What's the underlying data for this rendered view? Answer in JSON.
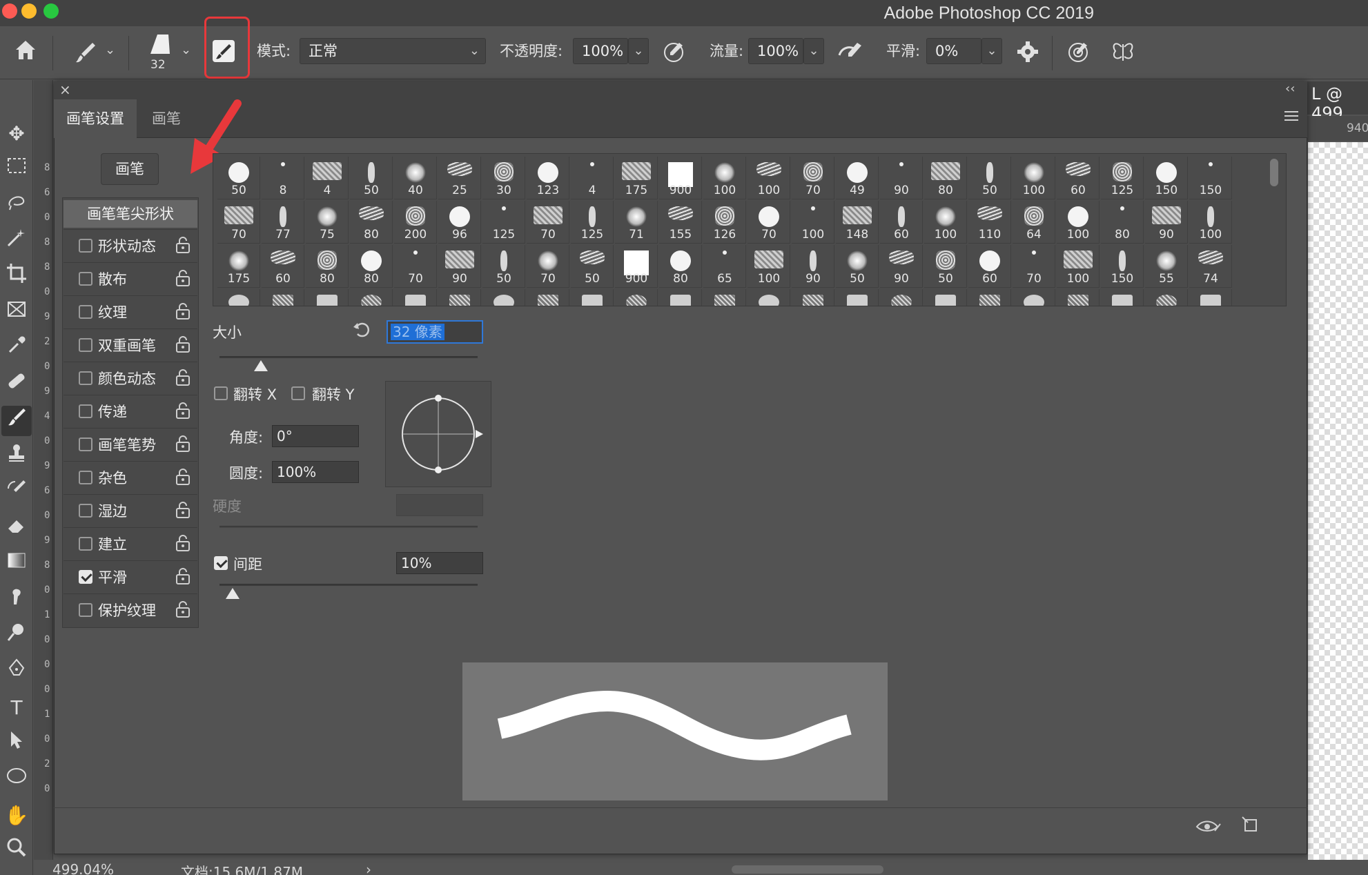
{
  "app": {
    "title": "Adobe Photoshop CC 2019"
  },
  "options_bar": {
    "brush_size": "32",
    "mode_label": "模式:",
    "mode_value": "正常",
    "opacity_label": "不透明度:",
    "opacity_value": "100%",
    "flow_label": "流量:",
    "flow_value": "100%",
    "smoothing_label": "平滑:",
    "smoothing_value": "0%"
  },
  "document": {
    "tab_text": "L @ 499",
    "ruler_value": "940",
    "zoom": "499.04%",
    "doc_info": "文档:15.6M/1.87M"
  },
  "left_ruler_labels": [
    "8",
    "6",
    "0",
    "8",
    "8",
    "0",
    "9",
    "2",
    "0",
    "9",
    "4",
    "0",
    "9",
    "6",
    "0",
    "9",
    "8",
    "0",
    "1",
    "0",
    "0",
    "0",
    "1",
    "0",
    "2",
    "0"
  ],
  "panel": {
    "tabs": [
      "画笔设置",
      "画笔"
    ],
    "brush_button": "画笔",
    "tip_shape": "画笔笔尖形状",
    "options": [
      {
        "label": "形状动态",
        "checked": false
      },
      {
        "label": "散布",
        "checked": false
      },
      {
        "label": "纹理",
        "checked": false
      },
      {
        "label": "双重画笔",
        "checked": false
      },
      {
        "label": "颜色动态",
        "checked": false
      },
      {
        "label": "传递",
        "checked": false
      },
      {
        "label": "画笔笔势",
        "checked": false
      },
      {
        "label": "杂色",
        "checked": false
      },
      {
        "label": "湿边",
        "checked": false
      },
      {
        "label": "建立",
        "checked": false
      },
      {
        "label": "平滑",
        "checked": true
      },
      {
        "label": "保护纹理",
        "checked": false
      }
    ],
    "presets": [
      [
        "50",
        "8",
        "4",
        "50",
        "40",
        "25",
        "30",
        "123",
        "4",
        "175",
        "900",
        "100",
        "100",
        "70",
        "49",
        "90",
        "80",
        "50",
        "100",
        "60",
        "125",
        "150",
        "150"
      ],
      [
        "70",
        "77",
        "75",
        "80",
        "200",
        "96",
        "125",
        "70",
        "125",
        "71",
        "155",
        "126",
        "70",
        "100",
        "148",
        "60",
        "100",
        "110",
        "64",
        "100",
        "80",
        "90",
        "100"
      ],
      [
        "175",
        "60",
        "80",
        "80",
        "70",
        "90",
        "50",
        "70",
        "50",
        "900",
        "80",
        "65",
        "100",
        "90",
        "50",
        "90",
        "50",
        "60",
        "70",
        "100",
        "150",
        "55",
        "74"
      ]
    ],
    "size_label": "大小",
    "size_value": "32 像素",
    "flip_x_label": "翻转 X",
    "flip_y_label": "翻转 Y",
    "angle_label": "角度:",
    "angle_value": "0°",
    "roundness_label": "圆度:",
    "roundness_value": "100%",
    "hardness_label": "硬度",
    "spacing_label": "间距",
    "spacing_value": "10%",
    "spacing_checked": true,
    "size_slider": 0.16,
    "spacing_slider": 0.05
  },
  "colors": {
    "accent_red": "#e8383b",
    "panel_bg": "#535353",
    "selection": "#1f6fd6"
  }
}
